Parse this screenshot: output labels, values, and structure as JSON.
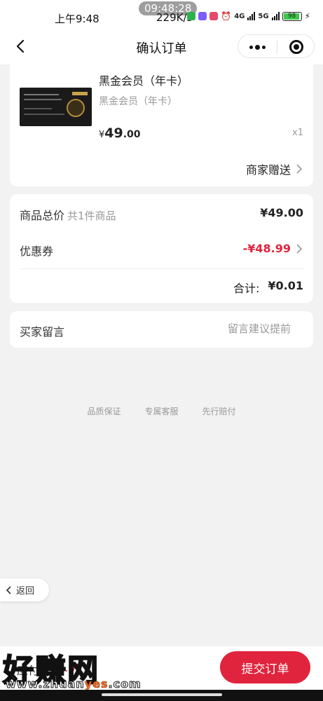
{
  "status_bar": {
    "time": "上午9:48",
    "center_clock": "09:48:28",
    "net_speed": "229K/s",
    "battery": "98",
    "net_4g": "4G",
    "net_5g": "5G"
  },
  "header": {
    "title": "确认订单"
  },
  "product": {
    "title": "黑金会员（年卡）",
    "subtitle": "黑金会员（年卡）",
    "currency": "¥",
    "price_int": "49",
    "price_dec": ".00",
    "quantity": "x1",
    "gift_label": "商家赠送"
  },
  "price_summary": {
    "total_label": "商品总价",
    "total_count": "共1件商品",
    "total_value": "¥49.00",
    "coupon_label": "优惠券",
    "coupon_value": "-¥48.99",
    "sum_label": "合计:",
    "sum_value": "¥0.01"
  },
  "message": {
    "label": "买家留言",
    "placeholder": "留言建议提前"
  },
  "guarantees": [
    "品质保证",
    "专属客服",
    "先行赔付"
  ],
  "float_back": {
    "label": "返回"
  },
  "bottom_bar": {
    "pay_label": "应付:",
    "pay_amount": "¥0.01",
    "submit_label": "提交订单"
  },
  "watermark": {
    "text": "好赚网",
    "url_prefix": "www.zhuan",
    "url_highlight": "yes",
    "url_suffix": ".com"
  },
  "colors": {
    "accent": "#e1243d",
    "coupon_red": "#e0243c",
    "background": "#f2f2f2"
  }
}
